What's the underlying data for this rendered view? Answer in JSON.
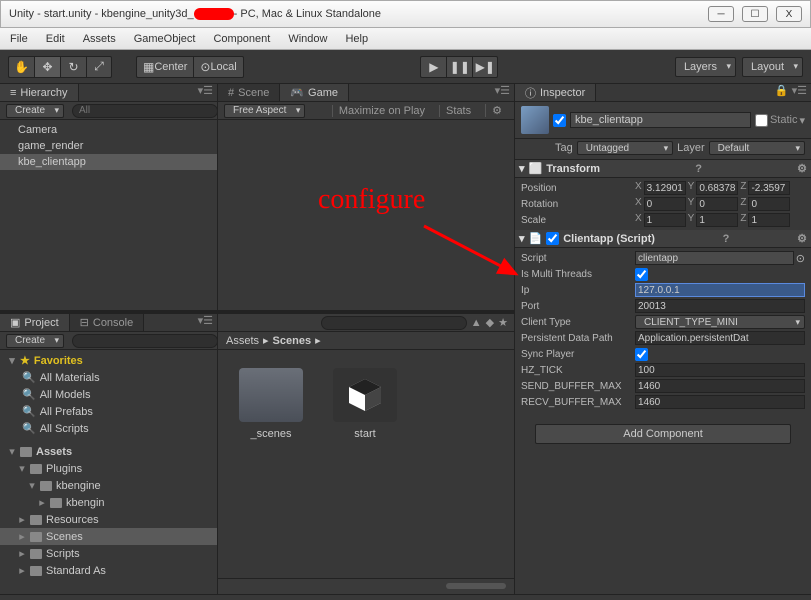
{
  "window": {
    "title_prefix": "Unity - start.unity - kbengine_unity3d_",
    "title_suffix": " - PC, Mac & Linux Standalone",
    "min": "─",
    "max": "☐",
    "close": "X"
  },
  "menu": {
    "file": "File",
    "edit": "Edit",
    "assets": "Assets",
    "gameobject": "GameObject",
    "component": "Component",
    "window": "Window",
    "help": "Help"
  },
  "toolbar": {
    "center": "Center",
    "local": "Local",
    "layers": "Layers",
    "layout": "Layout"
  },
  "hierarchy": {
    "tab": "Hierarchy",
    "create": "Create",
    "qall": "All",
    "items": [
      "Camera",
      "game_render",
      "kbe_clientapp"
    ]
  },
  "sceneview": {
    "scene_tab": "Scene",
    "game_tab": "Game",
    "free_aspect": "Free Aspect",
    "max": "Maximize on Play",
    "stats": "Stats"
  },
  "project": {
    "project_tab": "Project",
    "console_tab": "Console",
    "create": "Create",
    "favorites": "Favorites",
    "fav_items": [
      "All Materials",
      "All Models",
      "All Prefabs",
      "All Scripts"
    ],
    "assets": "Assets",
    "tree": [
      "Plugins",
      "kbengine",
      "kbengin",
      "Resources",
      "Scenes",
      "Scripts",
      "Standard As"
    ],
    "breadcrumb_assets": "Assets",
    "breadcrumb_scenes": "Scenes",
    "grid": {
      "scenes": "_scenes",
      "start": "start"
    }
  },
  "inspector": {
    "tab": "Inspector",
    "name": "kbe_clientapp",
    "static": "Static",
    "tag_label": "Tag",
    "tag_val": "Untagged",
    "layer_label": "Layer",
    "layer_val": "Default",
    "transform": {
      "title": "Transform",
      "pos": "Position",
      "px": "3.12901",
      "py": "0.68378",
      "pz": "-2.3597",
      "rot": "Rotation",
      "rx": "0",
      "ry": "0",
      "rz": "0",
      "scale": "Scale",
      "sx": "1",
      "sy": "1",
      "sz": "1"
    },
    "clientapp": {
      "title": "Clientapp (Script)",
      "script_label": "Script",
      "script_val": "clientapp",
      "multi_label": "Is Multi Threads",
      "multi_val": true,
      "ip_label": "Ip",
      "ip_val": "127.0.0.1",
      "port_label": "Port",
      "port_val": "20013",
      "ctype_label": "Client Type",
      "ctype_val": "CLIENT_TYPE_MINI",
      "pdata_label": "Persistent Data Path",
      "pdata_val": "Application.persistentDat",
      "sync_label": "Sync Player",
      "sync_val": true,
      "hz_label": "HZ_TICK",
      "hz_val": "100",
      "send_label": "SEND_BUFFER_MAX",
      "send_val": "1460",
      "recv_label": "RECV_BUFFER_MAX",
      "recv_val": "1460"
    },
    "addcomp": "Add Component"
  },
  "annotation": "configure"
}
